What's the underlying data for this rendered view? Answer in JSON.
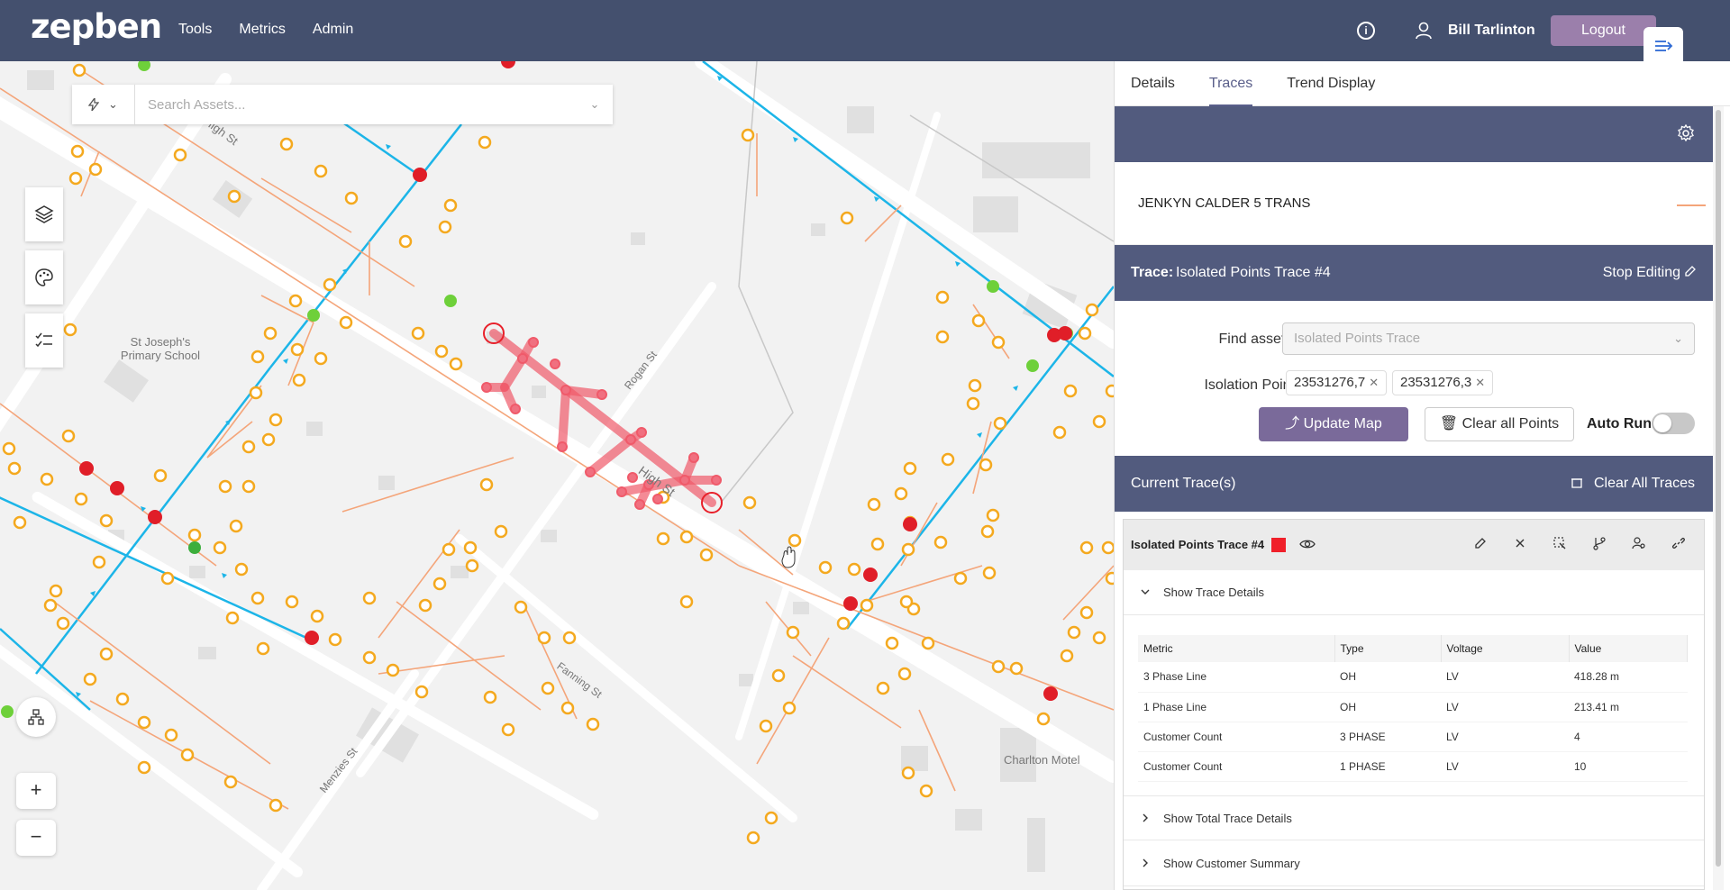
{
  "header": {
    "logo": "zepben",
    "nav": [
      "Tools",
      "Metrics",
      "Admin"
    ],
    "user": "Bill Tarlinton",
    "logout": "Logout"
  },
  "map": {
    "search_placeholder": "Search Assets...",
    "labels": {
      "school_line1": "St Joseph's",
      "school_line2": "Primary School",
      "high_st": "High St",
      "rogan_st": "Rogan St",
      "fanning_st": "Fanning St",
      "menzies_st": "Menzies St",
      "charlton_motel": "Charlton Motel",
      "high_st_top": "High St"
    },
    "zoom_in": "+",
    "zoom_out": "−"
  },
  "panel": {
    "tabs": [
      "Details",
      "Traces",
      "Trend Display"
    ],
    "active_tab": "Traces",
    "asset_name": "JENKYN CALDER 5 TRANS",
    "trace_label": "Trace:",
    "trace_name": "Isolated Points Trace #4",
    "stop_editing": "Stop Editing",
    "find_label": "Find asset(s)",
    "find_placeholder": "Isolated Points Trace",
    "isolation_label": "Isolation Points",
    "isolation_points": [
      "23531276,7",
      "23531276,3"
    ],
    "update_map": "Update Map",
    "clear_points": "Clear all Points",
    "auto_run": "Auto Run",
    "current_traces": "Current Trace(s)",
    "clear_all_traces": "Clear All Traces",
    "card": {
      "title": "Isolated Points Trace #4",
      "color": "#f0202a",
      "show_details": "Show Trace Details",
      "columns": [
        "Metric",
        "Type",
        "Voltage",
        "Value"
      ],
      "rows": [
        [
          "3 Phase Line",
          "OH",
          "LV",
          "418.28 m"
        ],
        [
          "1 Phase Line",
          "OH",
          "LV",
          "213.41 m"
        ],
        [
          "Customer Count",
          "3 PHASE",
          "LV",
          "4"
        ],
        [
          "Customer Count",
          "1 PHASE",
          "LV",
          "10"
        ]
      ],
      "show_total": "Show Total Trace Details",
      "show_customer": "Show Customer Summary"
    }
  }
}
